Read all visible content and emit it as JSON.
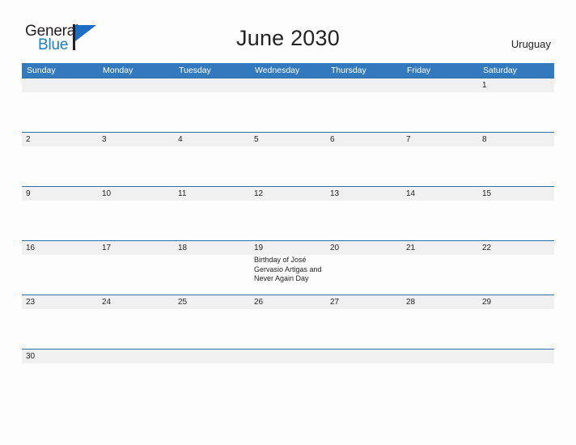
{
  "brand": {
    "word_one": "General",
    "word_two": "Blue"
  },
  "header": {
    "title": "June 2030",
    "country": "Uruguay"
  },
  "colors": {
    "header_blue": "#3279bd",
    "rule_blue": "#2f6fa8",
    "band_gray": "#f0f0f0",
    "logo_blue": "#1b7fc4",
    "page_bg": "#fdfdfd",
    "text": "#232323"
  },
  "calendar": {
    "weekdays": [
      "Sunday",
      "Monday",
      "Tuesday",
      "Wednesday",
      "Thursday",
      "Friday",
      "Saturday"
    ],
    "weeks": [
      {
        "days": [
          {
            "num": "",
            "event": ""
          },
          {
            "num": "",
            "event": ""
          },
          {
            "num": "",
            "event": ""
          },
          {
            "num": "",
            "event": ""
          },
          {
            "num": "",
            "event": ""
          },
          {
            "num": "",
            "event": ""
          },
          {
            "num": "1",
            "event": ""
          }
        ]
      },
      {
        "days": [
          {
            "num": "2",
            "event": ""
          },
          {
            "num": "3",
            "event": ""
          },
          {
            "num": "4",
            "event": ""
          },
          {
            "num": "5",
            "event": ""
          },
          {
            "num": "6",
            "event": ""
          },
          {
            "num": "7",
            "event": ""
          },
          {
            "num": "8",
            "event": ""
          }
        ]
      },
      {
        "days": [
          {
            "num": "9",
            "event": ""
          },
          {
            "num": "10",
            "event": ""
          },
          {
            "num": "11",
            "event": ""
          },
          {
            "num": "12",
            "event": ""
          },
          {
            "num": "13",
            "event": ""
          },
          {
            "num": "14",
            "event": ""
          },
          {
            "num": "15",
            "event": ""
          }
        ]
      },
      {
        "days": [
          {
            "num": "16",
            "event": ""
          },
          {
            "num": "17",
            "event": ""
          },
          {
            "num": "18",
            "event": ""
          },
          {
            "num": "19",
            "event": "Birthday of José Gervasio Artigas and Never Again Day"
          },
          {
            "num": "20",
            "event": ""
          },
          {
            "num": "21",
            "event": ""
          },
          {
            "num": "22",
            "event": ""
          }
        ]
      },
      {
        "days": [
          {
            "num": "23",
            "event": ""
          },
          {
            "num": "24",
            "event": ""
          },
          {
            "num": "25",
            "event": ""
          },
          {
            "num": "26",
            "event": ""
          },
          {
            "num": "27",
            "event": ""
          },
          {
            "num": "28",
            "event": ""
          },
          {
            "num": "29",
            "event": ""
          }
        ]
      },
      {
        "days": [
          {
            "num": "30",
            "event": ""
          },
          {
            "num": "",
            "event": ""
          },
          {
            "num": "",
            "event": ""
          },
          {
            "num": "",
            "event": ""
          },
          {
            "num": "",
            "event": ""
          },
          {
            "num": "",
            "event": ""
          },
          {
            "num": "",
            "event": ""
          }
        ]
      }
    ]
  }
}
